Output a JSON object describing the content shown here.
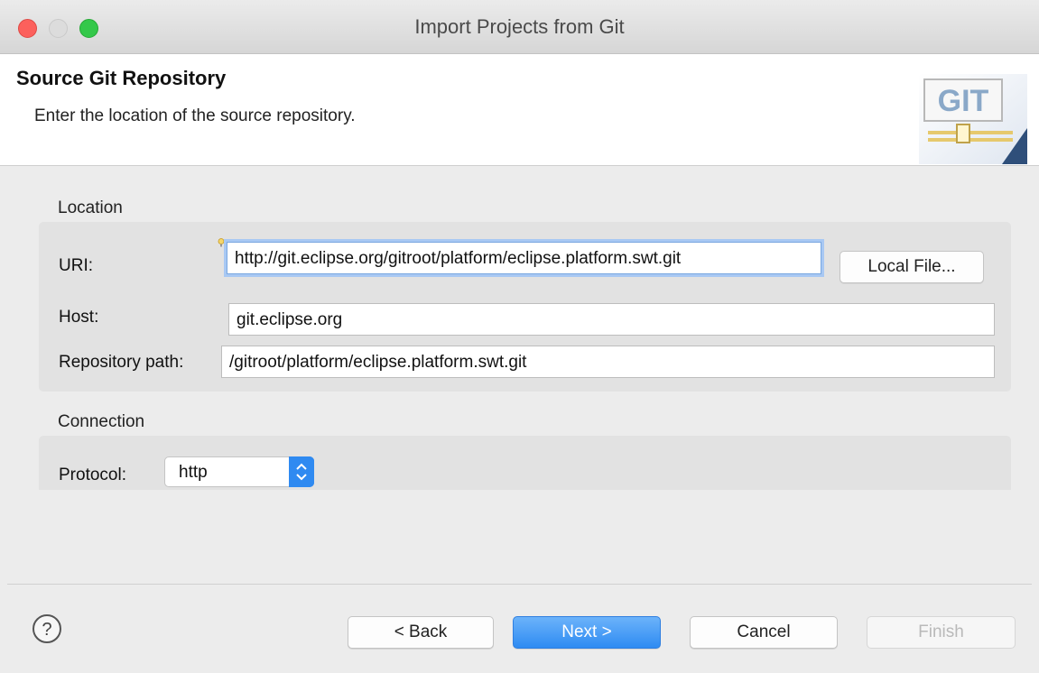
{
  "window": {
    "title": "Import Projects from Git"
  },
  "header": {
    "title": "Source Git Repository",
    "description": "Enter the location of the source repository.",
    "logo_text": "GIT",
    "logo_icon": "git-logo-icon"
  },
  "location": {
    "section_label": "Location",
    "uri_label": "URI:",
    "uri_value": "http://git.eclipse.org/gitroot/platform/eclipse.platform.swt.git",
    "local_file_label": "Local File...",
    "host_label": "Host:",
    "host_value": "git.eclipse.org",
    "repo_path_label": "Repository path:",
    "repo_path_value": "/gitroot/platform/eclipse.platform.swt.git"
  },
  "connection": {
    "section_label": "Connection",
    "protocol_label": "Protocol:",
    "protocol_value": "http"
  },
  "footer": {
    "back_label": "< Back",
    "next_label": "Next >",
    "cancel_label": "Cancel",
    "finish_label": "Finish"
  },
  "colors": {
    "accent": "#2e8bf2",
    "close": "#fc605c",
    "maximize": "#34c84a"
  }
}
